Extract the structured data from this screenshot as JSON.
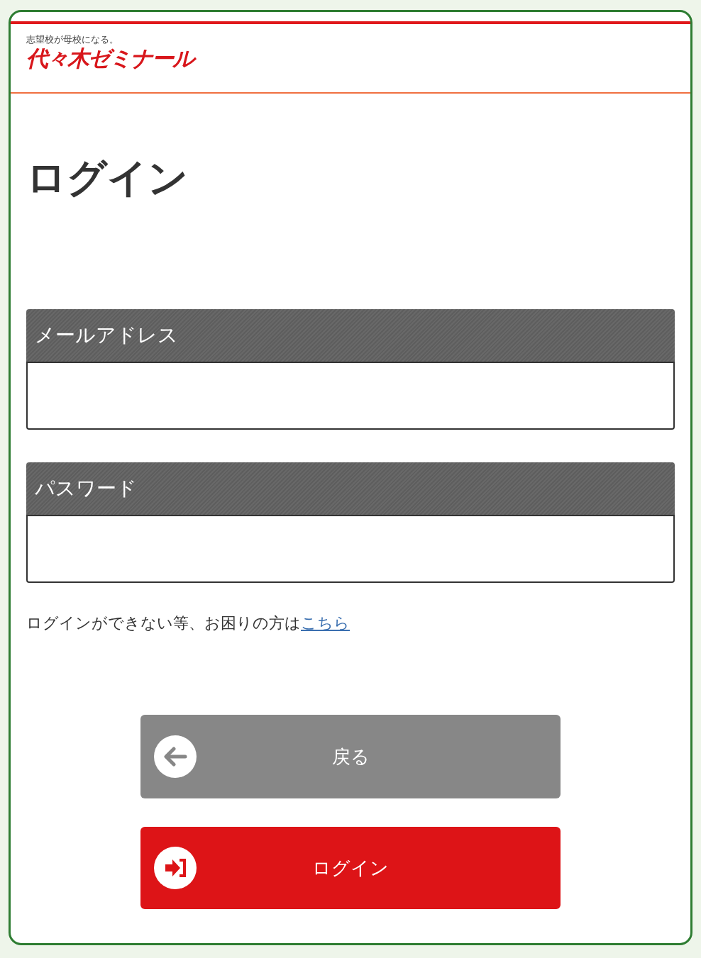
{
  "header": {
    "tagline": "志望校が母校になる。",
    "brand": "代々木ゼミナール"
  },
  "title": "ログイン",
  "fields": [
    {
      "label": "メールアドレス"
    },
    {
      "label": "パスワード"
    }
  ],
  "help": {
    "text": "ログインができない等、お困りの方は",
    "link": "こちら"
  },
  "buttons": [
    {
      "kind": "back",
      "label": "戻る"
    },
    {
      "kind": "login",
      "label": "ログイン"
    }
  ]
}
